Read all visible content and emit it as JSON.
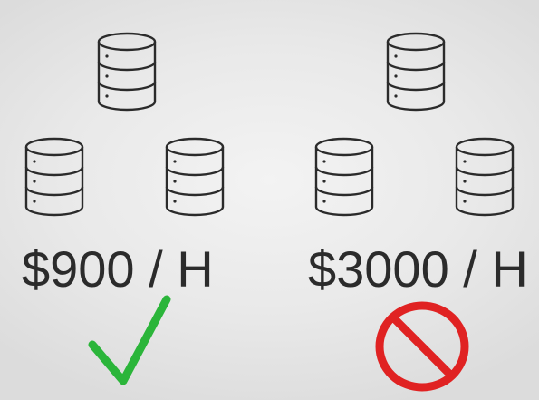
{
  "options": [
    {
      "price_label": "$900 / H",
      "status": "approved",
      "status_icon": "check-icon",
      "status_color": "#2bb53a",
      "database_count": 3
    },
    {
      "price_label": "$3000 / H",
      "status": "rejected",
      "status_icon": "prohibited-icon",
      "status_color": "#e02222",
      "database_count": 3
    }
  ],
  "icons": {
    "database": "database-icon"
  }
}
